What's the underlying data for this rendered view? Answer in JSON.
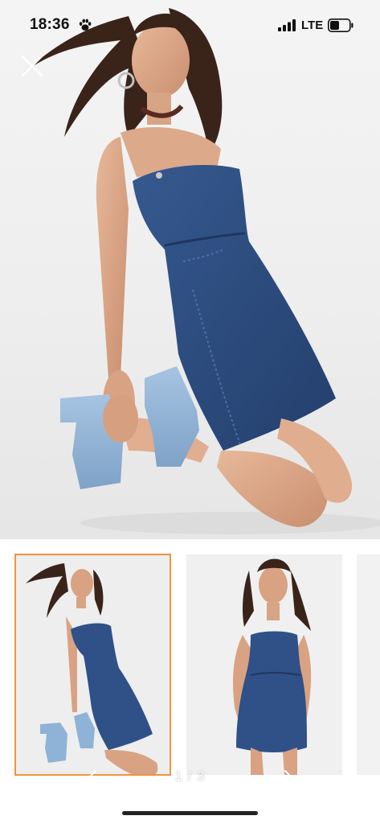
{
  "status_bar": {
    "time": "18:36",
    "network": "LTE",
    "icons": [
      "paw-icon",
      "signal-icon",
      "battery-icon"
    ]
  },
  "gallery": {
    "close_icon": "close-icon",
    "page_indicator": "1 / 3",
    "current_page": 1,
    "total_pages": 3,
    "selected_thumbnail": 1,
    "thumbnail_count": 3,
    "colors": {
      "selection_border": "#f0933c",
      "denim": "#2f5188",
      "denim_dark": "#24406f",
      "boot": "#8fb3d6",
      "background": "#f1f1f1"
    }
  }
}
